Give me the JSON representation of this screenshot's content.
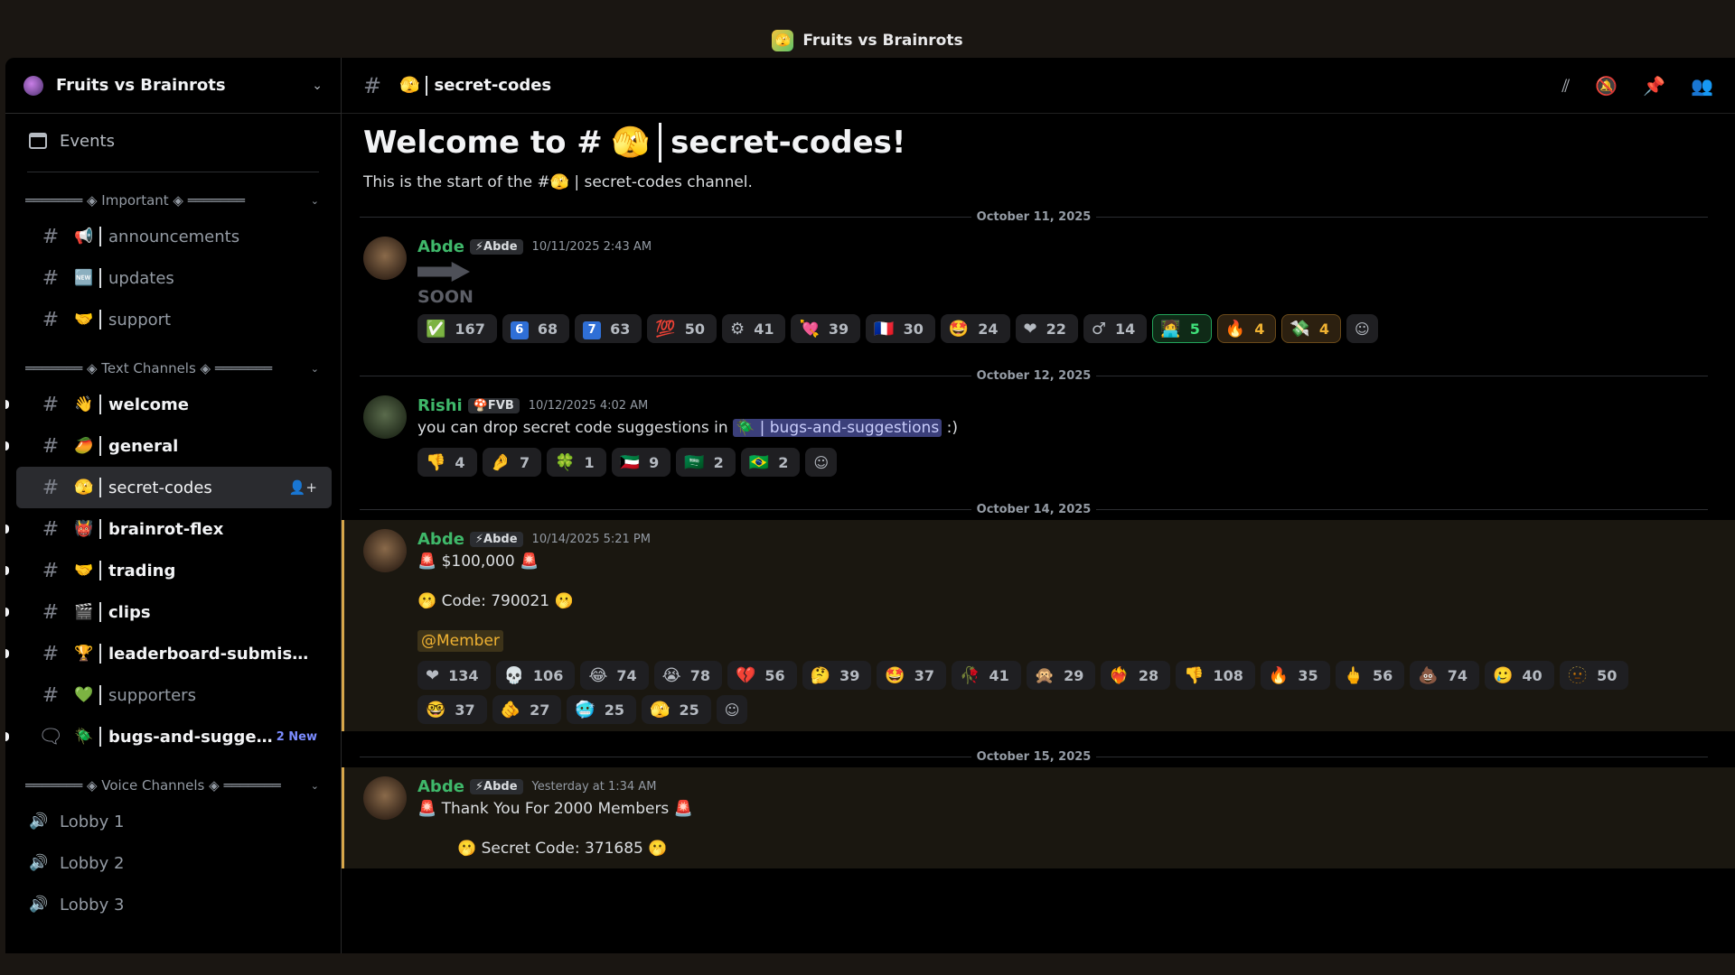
{
  "window": {
    "title": "Fruits vs Brainrots"
  },
  "sidebar": {
    "server_name": "Fruits vs Brainrots",
    "events_label": "Events",
    "categories": {
      "important": "═══════ ◈ Important ◈ ═══════",
      "text": "═══════ ◈ Text Channels ◈ ═══════",
      "voice": "═══════ ◈ Voice Channels ◈ ═══════"
    },
    "important_channels": [
      {
        "emoji": "📢",
        "label": "announcements"
      },
      {
        "emoji": "🆕",
        "label": "updates"
      },
      {
        "emoji": "🤝",
        "label": "support"
      }
    ],
    "text_channels": [
      {
        "emoji": "👋",
        "label": "welcome"
      },
      {
        "emoji": "🥭",
        "label": "general"
      },
      {
        "emoji": "🫣",
        "label": "secret-codes"
      },
      {
        "emoji": "👹",
        "label": "brainrot-flex"
      },
      {
        "emoji": "🤝",
        "label": "trading"
      },
      {
        "emoji": "🎬",
        "label": "clips"
      },
      {
        "emoji": "🏆",
        "label": "leaderboard-submission"
      },
      {
        "emoji": "💚",
        "label": "supporters"
      },
      {
        "emoji": "🪲",
        "label": "bugs-and-suggesti...",
        "badge": "2 New"
      }
    ],
    "voice_channels": [
      "Lobby 1",
      "Lobby 2",
      "Lobby 3"
    ]
  },
  "channel_header": {
    "emoji": "🫣",
    "name": "secret-codes"
  },
  "welcome": {
    "title_prefix": "Welcome to #",
    "emoji": "🫣",
    "title_suffix": "secret-codes!",
    "subtitle": "This is the start of the #🫣 | secret-codes channel."
  },
  "messages": [
    {
      "date": "October 11, 2025",
      "author": "Abde",
      "tag": "⚡Abde",
      "time": "10/11/2025 2:43 AM",
      "soon": "SOON",
      "reactions": [
        {
          "emoji": "✅",
          "count": "167"
        },
        {
          "emoji": "6",
          "count": "68"
        },
        {
          "emoji": "7",
          "count": "63"
        },
        {
          "emoji": "💯",
          "count": "50"
        },
        {
          "emoji": "⚙",
          "count": "41"
        },
        {
          "emoji": "💘",
          "count": "39"
        },
        {
          "emoji": "🇫🇷",
          "count": "30"
        },
        {
          "emoji": "🤩",
          "count": "24"
        },
        {
          "emoji": "❤",
          "count": "22"
        },
        {
          "emoji": "♂",
          "count": "14"
        },
        {
          "emoji": "🧑‍💻",
          "count": "5"
        },
        {
          "emoji": "🔥",
          "count": "4"
        },
        {
          "emoji": "💸",
          "count": "4"
        }
      ]
    },
    {
      "date": "October 12, 2025",
      "author": "Rishi",
      "tag": "🍄FVB",
      "time": "10/12/2025 4:02 AM",
      "text_before": "you can drop secret code suggestions in ",
      "mention": "🪲 | bugs-and-suggestions",
      "text_after": " :)",
      "reactions": [
        {
          "emoji": "👎",
          "count": "4"
        },
        {
          "emoji": "🤌",
          "count": "7"
        },
        {
          "emoji": "🍀",
          "count": "1"
        },
        {
          "emoji": "🇰🇼",
          "count": "9"
        },
        {
          "emoji": "🇸🇦",
          "count": "2"
        },
        {
          "emoji": "🇧🇷",
          "count": "2"
        }
      ]
    },
    {
      "date": "October 14, 2025",
      "author": "Abde",
      "tag": "⚡Abde",
      "time": "10/14/2025 5:21 PM",
      "line1": "🚨 $100,000 🚨",
      "line2": "🫢 Code: 790021 🫢",
      "mention": "@Member",
      "reactions": [
        {
          "emoji": "❤",
          "count": "134"
        },
        {
          "emoji": "💀",
          "count": "106"
        },
        {
          "emoji": "😂",
          "count": "74"
        },
        {
          "emoji": "😭",
          "count": "78"
        },
        {
          "emoji": "💔",
          "count": "56"
        },
        {
          "emoji": "🤔",
          "count": "39"
        },
        {
          "emoji": "🤩",
          "count": "37"
        },
        {
          "emoji": "🥀",
          "count": "41"
        },
        {
          "emoji": "🙊",
          "count": "29"
        },
        {
          "emoji": "❤‍🔥",
          "count": "28"
        },
        {
          "emoji": "👎",
          "count": "108"
        },
        {
          "emoji": "🔥",
          "count": "35"
        },
        {
          "emoji": "🖕",
          "count": "56"
        },
        {
          "emoji": "💩",
          "count": "74"
        },
        {
          "emoji": "🥲",
          "count": "40"
        },
        {
          "emoji": "🫥",
          "count": "50"
        },
        {
          "emoji": "🤓",
          "count": "37"
        },
        {
          "emoji": "🫵",
          "count": "27"
        },
        {
          "emoji": "🥶",
          "count": "25"
        },
        {
          "emoji": "🫣",
          "count": "25"
        }
      ]
    },
    {
      "date": "October 15, 2025",
      "author": "Abde",
      "tag": "⚡Abde",
      "time": "Yesterday at 1:34 AM",
      "line1": "🚨 Thank You For 2000 Members 🚨",
      "line2": "🫢 Secret Code: 371685 🫢"
    }
  ],
  "colors": {
    "accent_green": "#3fb86a",
    "highlight_border": "#d6a64a",
    "mention_bg": "#3b3f7a"
  }
}
